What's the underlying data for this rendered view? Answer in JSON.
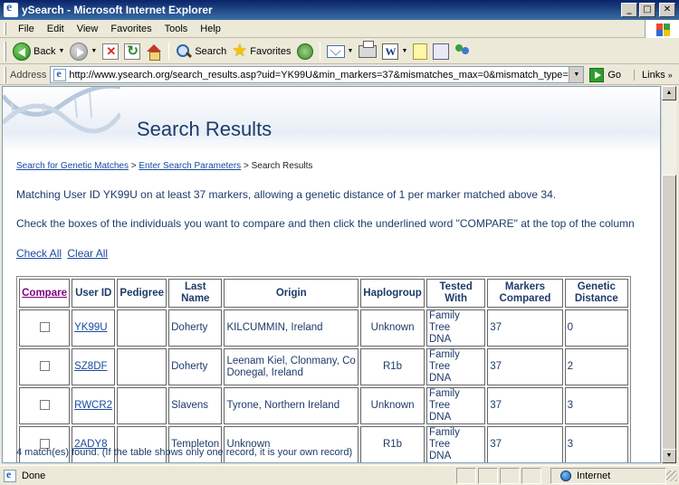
{
  "window": {
    "title": "ySearch - Microsoft Internet Explorer",
    "buttons": {
      "minimize": "_",
      "maximize": "□",
      "close": "✕"
    }
  },
  "menubar": {
    "items": [
      {
        "label": "File"
      },
      {
        "label": "Edit"
      },
      {
        "label": "View"
      },
      {
        "label": "Favorites"
      },
      {
        "label": "Tools"
      },
      {
        "label": "Help"
      }
    ]
  },
  "toolbar": {
    "back_label": "Back",
    "search_label": "Search",
    "favorites_label": "Favorites",
    "icons": [
      "back-icon",
      "forward-icon",
      "stop-icon",
      "refresh-icon",
      "home-icon",
      "search-icon",
      "favorites-icon",
      "media-icon",
      "mail-icon",
      "print-icon",
      "word-icon",
      "note-icon",
      "research-icon",
      "messenger-icon"
    ]
  },
  "addressbar": {
    "label": "Address",
    "url": "http://www.ysearch.org/search_results.asp?uid=YK99U&min_markers=37&mismatches_max=0&mismatch_type=sliding&mismatche",
    "go_label": "Go",
    "links_label": "Links"
  },
  "page": {
    "title": "Search Results",
    "breadcrumb": {
      "link1": "Search for Genetic Matches",
      "sep1": " > ",
      "link2": "Enter Search Parameters",
      "sep2": " > ",
      "current": "Search Results"
    },
    "match_text": "Matching User ID YK99U on at least 37 markers, allowing a genetic distance of 1 per marker matched above 34.",
    "check_text": "Check the boxes of the individuals you want to compare and then click the underlined word \"COMPARE\" at the top of the column",
    "check_all": "Check All",
    "clear_all": "Clear All",
    "found_text": "4 match(es) found. (If the table shows only one record, it is your own record)"
  },
  "table": {
    "headers": {
      "compare": "Compare",
      "user_id": "User ID",
      "pedigree": "Pedigree",
      "last_name_1": "Last",
      "last_name_2": "Name",
      "origin": "Origin",
      "haplogroup": "Haplogroup",
      "tested_1": "Tested",
      "tested_2": "With",
      "markers_1": "Markers",
      "markers_2": "Compared",
      "genetic_1": "Genetic",
      "genetic_2": "Distance"
    },
    "rows": [
      {
        "user_id": "YK99U",
        "pedigree": "",
        "last_name": "Doherty",
        "origin": "KILCUMMIN, Ireland",
        "haplogroup": "Unknown",
        "tested_1": "Family Tree",
        "tested_2": "DNA",
        "markers": "37",
        "distance": "0"
      },
      {
        "user_id": "SZ8DF",
        "pedigree": "",
        "last_name": "Doherty",
        "origin": "Leenam Kiel, Clonmany, Co Donegal, Ireland",
        "haplogroup": "R1b",
        "tested_1": "Family Tree",
        "tested_2": "DNA",
        "markers": "37",
        "distance": "2"
      },
      {
        "user_id": "RWCR2",
        "pedigree": "",
        "last_name": "Slavens",
        "origin": "Tyrone, Northern Ireland",
        "haplogroup": "Unknown",
        "tested_1": "Family Tree",
        "tested_2": "DNA",
        "markers": "37",
        "distance": "3"
      },
      {
        "user_id": "2ADY8",
        "pedigree": "",
        "last_name": "Templeton",
        "origin": "Unknown",
        "haplogroup": "R1b",
        "tested_1": "Family Tree",
        "tested_2": "DNA",
        "markers": "37",
        "distance": "3"
      }
    ]
  },
  "statusbar": {
    "text": "Done",
    "zone": "Internet"
  },
  "colors": {
    "heading": "#1d3b6a",
    "link": "#1a4aa0",
    "visited_link": "#800080",
    "titlebar": "#0a246a"
  }
}
